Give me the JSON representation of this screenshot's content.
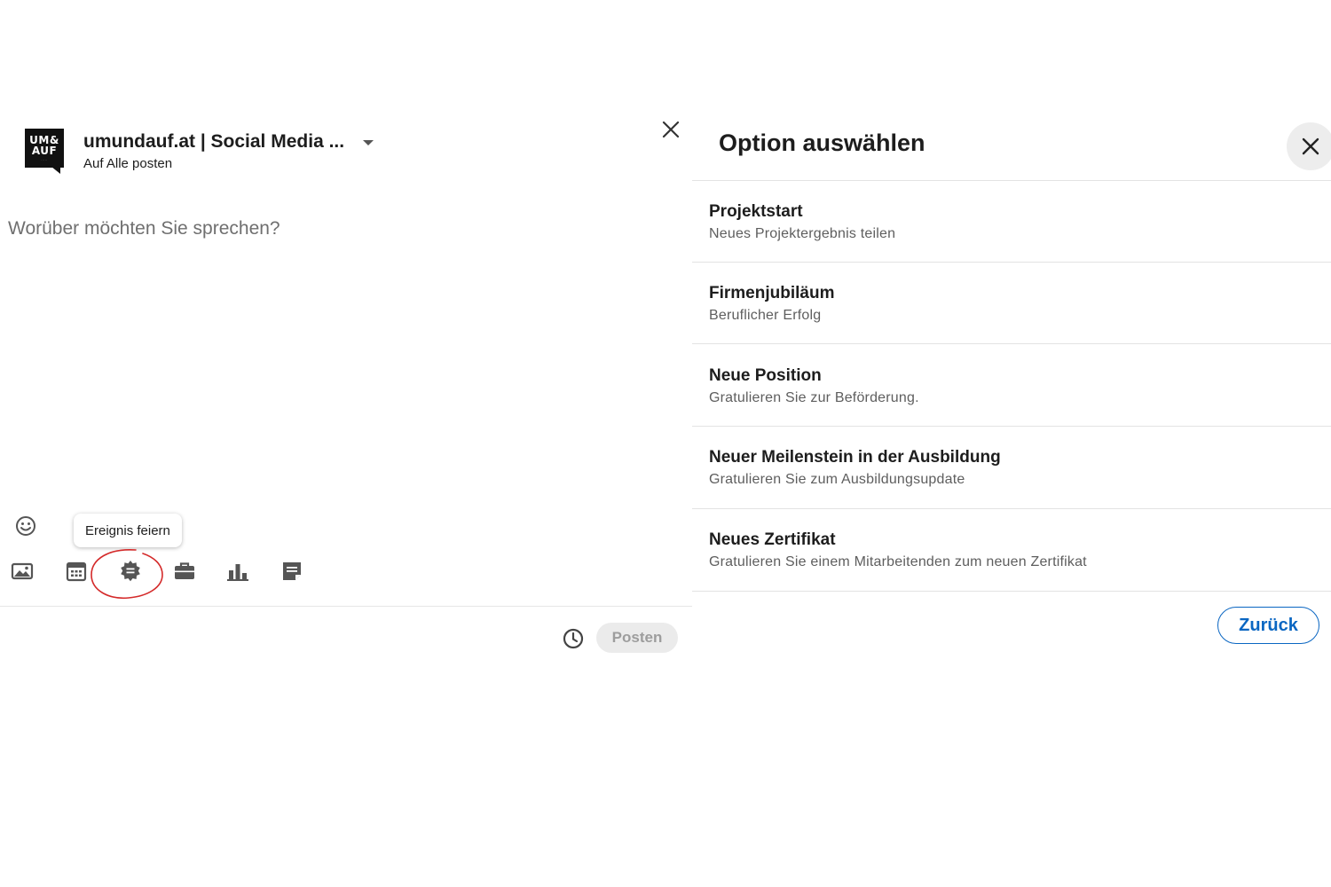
{
  "composer": {
    "logo_text_top": "UM&",
    "logo_text_bottom": "AUF",
    "account_name": "umundauf.at | Social Media ...",
    "audience": "Auf Alle posten",
    "placeholder": "Worüber möchten Sie sprechen?",
    "tooltip": "Ereignis feiern",
    "post_button": "Posten",
    "highlight_color": "#d42a2a"
  },
  "panel": {
    "title": "Option auswählen",
    "options": [
      {
        "title": "Projektstart",
        "subtitle": "Neues Projektergebnis teilen"
      },
      {
        "title": "Firmenjubiläum",
        "subtitle": "Beruflicher Erfolg"
      },
      {
        "title": "Neue Position",
        "subtitle": "Gratulieren Sie zur Beförderung."
      },
      {
        "title": "Neuer Meilenstein in der Ausbildung",
        "subtitle": "Gratulieren Sie zum Ausbildungsupdate"
      },
      {
        "title": "Neues Zertifikat",
        "subtitle": "Gratulieren Sie einem Mitarbeitenden zum neuen Zertifikat"
      }
    ],
    "back_button": "Zurück",
    "accent_color": "#0a66c2"
  },
  "icons": {
    "toolbar": [
      "image-icon",
      "calendar-icon",
      "celebrate-icon",
      "briefcase-icon",
      "bar-chart-icon",
      "document-icon"
    ],
    "other": [
      "emoji-icon",
      "close-icon",
      "clock-icon",
      "chevron-down-icon"
    ]
  }
}
